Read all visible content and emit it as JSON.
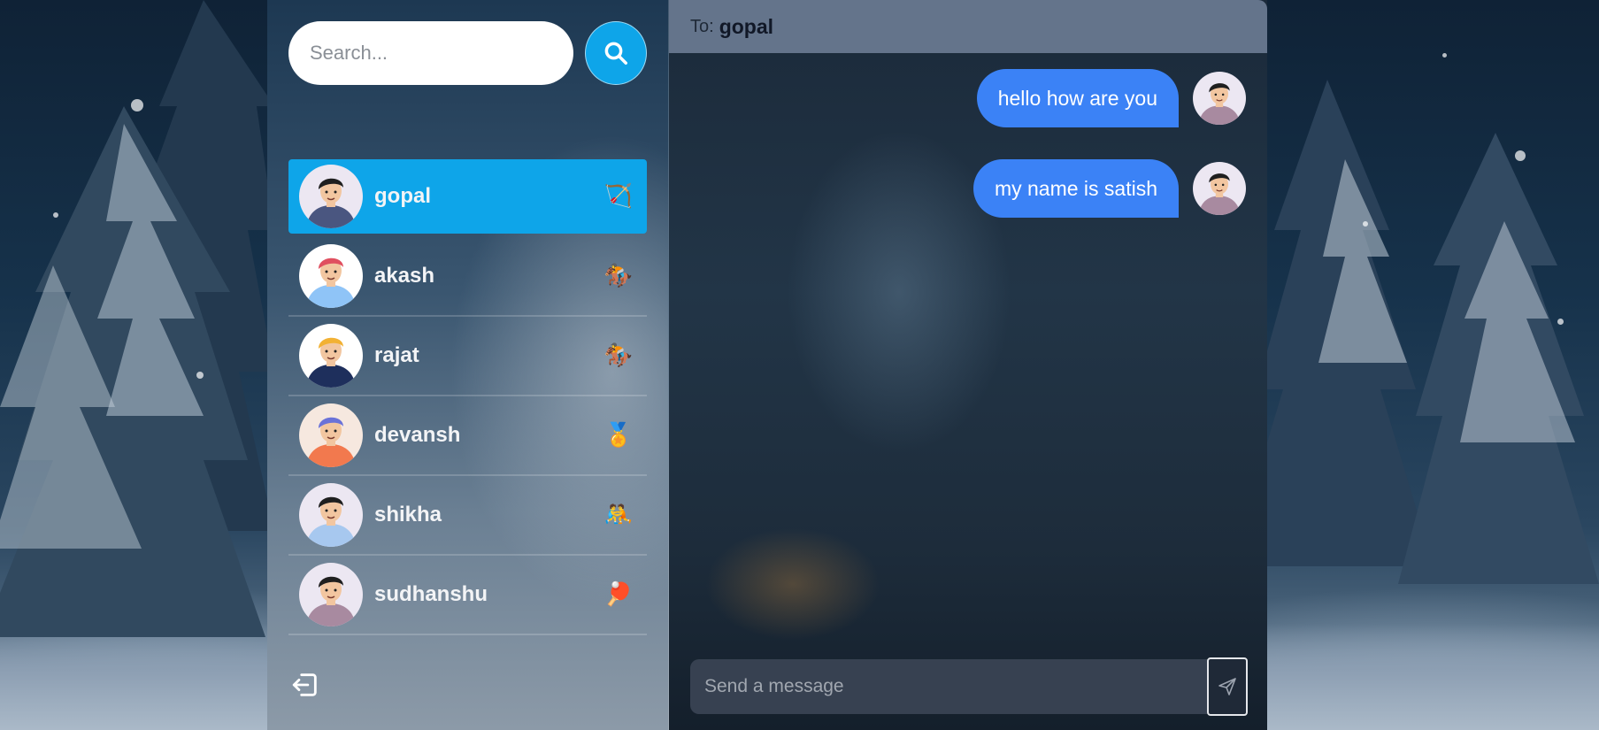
{
  "sidebar": {
    "search": {
      "placeholder": "Search..."
    },
    "users": [
      {
        "name": "gopal",
        "emoji": "🏹",
        "active": true,
        "skin": "#f2c6a0",
        "hair": "#1f1f1f",
        "shirt": "#4a5680",
        "bg": "#ece7f2"
      },
      {
        "name": "akash",
        "emoji": "🏇",
        "active": false,
        "skin": "#f2c6a0",
        "hair": "#e04f5f",
        "shirt": "#8fc4f7",
        "bg": "#ffffff"
      },
      {
        "name": "rajat",
        "emoji": "🏇",
        "active": false,
        "skin": "#f2c6a0",
        "hair": "#f2b134",
        "shirt": "#1e2f5c",
        "bg": "#ffffff"
      },
      {
        "name": "devansh",
        "emoji": "🏅",
        "active": false,
        "skin": "#f2c6a0",
        "hair": "#6a72d8",
        "shirt": "#f2794e",
        "bg": "#f6e8df"
      },
      {
        "name": "shikha",
        "emoji": "🤼",
        "active": false,
        "skin": "#f2c6a0",
        "hair": "#1f1f1f",
        "shirt": "#a7c8ef",
        "bg": "#ece7f2"
      },
      {
        "name": "sudhanshu",
        "emoji": "🏓",
        "active": false,
        "skin": "#f2c6a0",
        "hair": "#1f1f1f",
        "shirt": "#a88aa0",
        "bg": "#ece7f2"
      }
    ],
    "logout_icon": "logout-icon"
  },
  "chat": {
    "to_label": "To:",
    "to_name": "gopal",
    "messages": [
      {
        "text": "hello how are you"
      },
      {
        "text": "my name is satish"
      }
    ],
    "composer": {
      "placeholder": "Send a message"
    }
  },
  "colors": {
    "accent": "#0ea5e9",
    "bubble": "#3b82f6",
    "header": "#64748b",
    "composer": "#374151"
  }
}
